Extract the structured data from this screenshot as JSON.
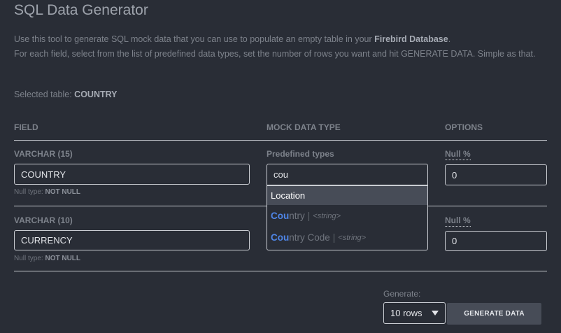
{
  "header": {
    "title": "SQL Data Generator"
  },
  "intro": {
    "line1_prefix": "Use this tool to generate SQL mock data that you can use to populate an empty table in your ",
    "line1_bold": "Firebird Database",
    "line1_suffix": ".",
    "line2": "For each field, select from the list of predefined data types, set the number of rows you want and hit GENERATE DATA. Simple as that."
  },
  "selected_table": {
    "label": "Selected table: ",
    "value": "COUNTRY"
  },
  "columns": {
    "field": "FIELD",
    "mock_type": "MOCK DATA TYPE",
    "options": "OPTIONS"
  },
  "fields": [
    {
      "type_label": "VARCHAR (15)",
      "name": "COUNTRY",
      "null_type_label": "Null type: ",
      "null_type_value": "NOT NULL",
      "predefined_label": "Predefined types",
      "search_value": "cou",
      "null_pct_label": "Null %",
      "null_pct_value": "0"
    },
    {
      "type_label": "VARCHAR (10)",
      "name": "CURRENCY",
      "null_type_label": "Null type: ",
      "null_type_value": "NOT NULL",
      "null_pct_label": "Null %",
      "null_pct_value": "0"
    }
  ],
  "dropdown": {
    "group": "Location",
    "items": [
      {
        "match": "Cou",
        "rest": "ntry",
        "sep": "|",
        "kind": "<string>"
      },
      {
        "match": "Cou",
        "rest": "ntry Code",
        "sep": "|",
        "kind": "<string>"
      }
    ]
  },
  "generate": {
    "label": "Generate:",
    "rows_selected": "10 rows",
    "button": "GENERATE DATA"
  },
  "colors": {
    "background": "#292d36",
    "highlight": "#4f86e8",
    "button_bg": "#474c57"
  },
  "icons": {
    "select_caret": "chevron-down-icon"
  }
}
